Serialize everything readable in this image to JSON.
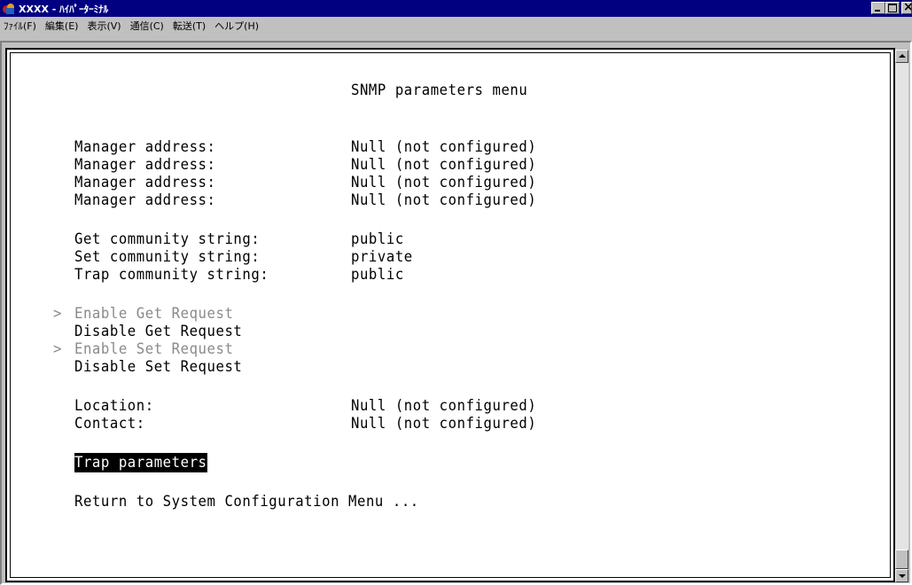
{
  "window": {
    "title": "XXXX - ﾊｲﾊﾟｰﾀｰﾐﾅﾙ"
  },
  "menubar": {
    "items": [
      "ﾌｧｲﾙ(F)",
      "編集(E)",
      "表示(V)",
      "通信(C)",
      "転送(T)",
      "ヘルプ(H)"
    ]
  },
  "terminal": {
    "title": "SNMP parameters menu",
    "managers": [
      {
        "label": "Manager address:",
        "value": "Null (not configured)"
      },
      {
        "label": "Manager address:",
        "value": "Null (not configured)"
      },
      {
        "label": "Manager address:",
        "value": "Null (not configured)"
      },
      {
        "label": "Manager address:",
        "value": "Null (not configured)"
      }
    ],
    "communities": [
      {
        "label": "Get community string:",
        "value": "public"
      },
      {
        "label": "Set community string:",
        "value": "private"
      },
      {
        "label": "Trap community string:",
        "value": "public"
      }
    ],
    "marker": ">",
    "requests": {
      "enable_get": "Enable Get Request",
      "disable_get": "Disable Get Request",
      "enable_set": "Enable Set Request",
      "disable_set": "Disable Set Request"
    },
    "location": {
      "label": "Location:",
      "value": "Null (not configured)"
    },
    "contact": {
      "label": "Contact:",
      "value": "Null (not configured)"
    },
    "trap_parameters": "Trap parameters",
    "return": "Return to System Configuration Menu ..."
  },
  "colors": {
    "titlebar": "#000080",
    "dimmed_text": "#8a8a8a",
    "highlight_bg": "#000000"
  }
}
